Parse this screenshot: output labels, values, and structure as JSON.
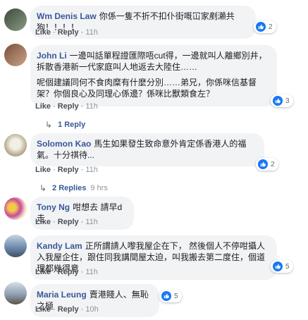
{
  "comments": [
    {
      "name": "Wm Denis Law",
      "text": "你係一隻不折不扣仆街嘅冚家剷瀨共狗！！！！",
      "reactions": "2",
      "like": "Like",
      "reply": "Reply",
      "time": "11h",
      "avatar_colors": [
        "#3b4a3a",
        "#8c9b84"
      ]
    },
    {
      "name": "John Li",
      "text": "一邊叫話單程證匯際唔cut得，一邊就叫人離鄉別井，拆散香港新一代家庭叫人地返去大陸住……",
      "text2": "呢個建議同何不食肉糜有什麼分別……弟兄，你係咪信基督架？你個良心及同理心係邊？係咪比獸類食左？",
      "reactions": "3",
      "like": "Like",
      "reply": "Reply",
      "time": "11h",
      "replies": "1 Reply",
      "avatar_colors": [
        "#7a4e3a",
        "#c9a48a"
      ]
    },
    {
      "name": "Solomon Kao",
      "text": "馬生如果發生致命意外肯定係香港人的福氣。十分祺待...",
      "reactions": "2",
      "like": "Like",
      "reply": "Reply",
      "time": "11h",
      "replies": "2 Replies",
      "replies_time": "9 hrs",
      "avatar_colors": [
        "#d8d2c0",
        "#a89a78"
      ]
    },
    {
      "name": "Tony Ng",
      "text": "咁想去 請早d走",
      "like": "Like",
      "reply": "Reply",
      "time": "11h",
      "avatar_colors": [
        "#f2c94c",
        "#c74a9a"
      ]
    },
    {
      "name": "Kandy Lam",
      "text": "正所謂請人嚟我屋企在下， 然後個人不停咁攝人入我屋企住，跟住同我講間屋太迫，叫我搬去第二度住，個道理都幾得意",
      "reactions": "5",
      "like": "Like",
      "reply": "Reply",
      "time": "11h",
      "avatar_colors": [
        "#6a86a8",
        "#c7d3e0"
      ]
    },
    {
      "name": "Maria Leung",
      "text": "賣港賤人、無恥之極",
      "reactions": "5",
      "like": "Like",
      "reply": "Reply",
      "time": "10h",
      "avatar_colors": [
        "#8fa0b4",
        "#d9dee5"
      ]
    }
  ]
}
